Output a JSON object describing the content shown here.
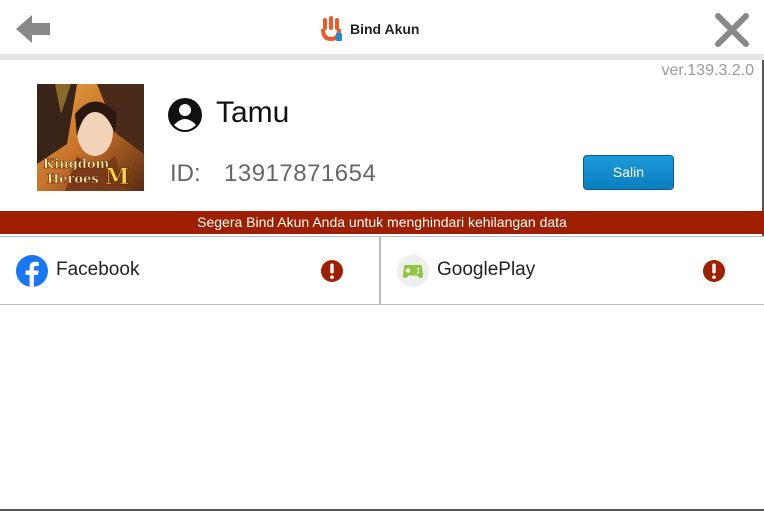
{
  "header": {
    "title": "Bind Akun",
    "back_icon": "back-arrow-icon",
    "close_icon": "close-icon",
    "logo_icon": "app-logo-icon"
  },
  "version": "ver.139.3.2.0",
  "profile": {
    "username": "Tamu",
    "id_label": "ID:",
    "id_value": "13917871654",
    "copy_label": "Salin",
    "avatar_logo_text": "Kingdom Heroes M"
  },
  "warning": "Segera Bind Akun Anda untuk menghindari kehilangan data",
  "bind_options": [
    {
      "label": "Facebook",
      "icon": "facebook-icon",
      "status_icon": "alert-icon"
    },
    {
      "label": "GooglePlay",
      "icon": "google-play-games-icon",
      "status_icon": "alert-icon"
    }
  ],
  "colors": {
    "warning_bar": "#9e2000",
    "copy_button": "#0a7ec0",
    "facebook": "#1877f2",
    "alert": "#9e2000"
  }
}
